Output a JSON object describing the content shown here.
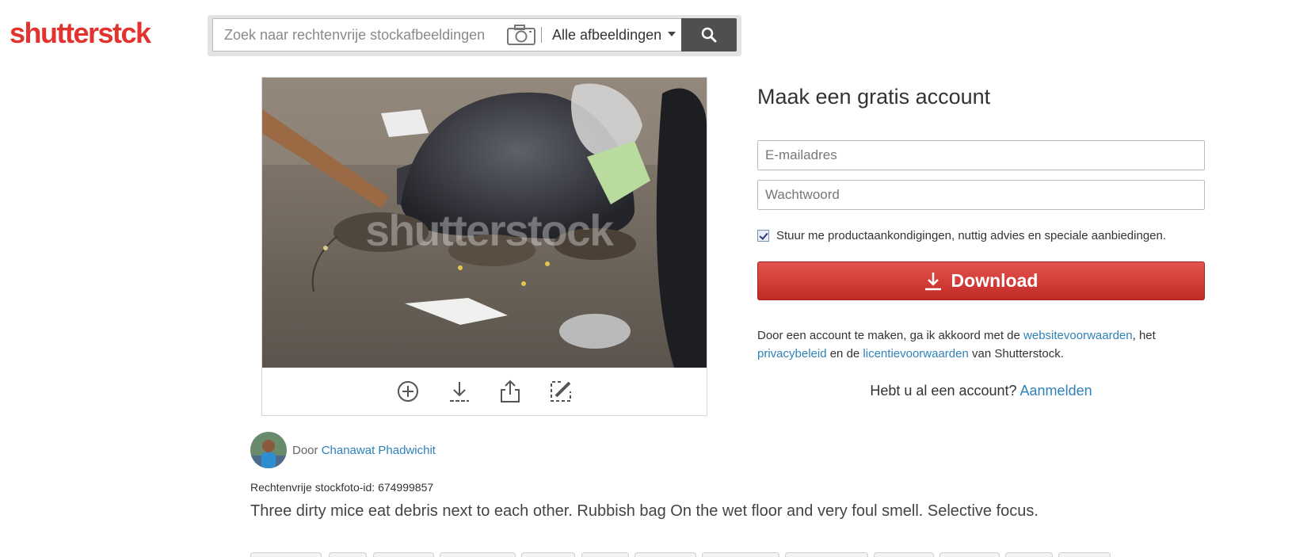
{
  "header": {
    "logo_text_main": "shutterst",
    "logo_text_accent": "ck",
    "search": {
      "placeholder": "Zoek naar rechtenvrije stockafbeeldingen",
      "type_selected": "Alle afbeeldingen"
    }
  },
  "image": {
    "watermark": "shutterstock",
    "tools": [
      "add-to-collection",
      "download",
      "share",
      "edit"
    ]
  },
  "signup": {
    "title": "Maak een gratis account",
    "email_placeholder": "E-mailadres",
    "password_placeholder": "Wachtwoord",
    "optin_label": "Stuur me productaankondigingen, nuttig advies en speciale aanbiedingen.",
    "optin_checked": true,
    "download_label": "Download",
    "terms": {
      "part1": "Door een account te maken, ga ik akkoord met de ",
      "link1": "websitevoorwaarden",
      "part2": ", het ",
      "link2": "privacybeleid",
      "part3": " en de ",
      "link3": "licentievoorwaarden",
      "part4": " van Shutterstock."
    },
    "have_account_text": "Hebt u al een account? ",
    "login_link": "Aanmelden"
  },
  "details": {
    "by_prefix": "Door ",
    "contributor": "Chanawat Phadwichit",
    "stock_id_label": "Rechtenvrije stockfoto-id: 674999857",
    "description": "Three dirty mice eat debris next to each other. Rubbish bag On the wet floor and very foul smell. Selective focus."
  },
  "colors": {
    "brand_red": "#e2332e",
    "link_blue": "#2e82b8",
    "button_red": "#c12a26",
    "search_button": "#4f4f4f"
  }
}
